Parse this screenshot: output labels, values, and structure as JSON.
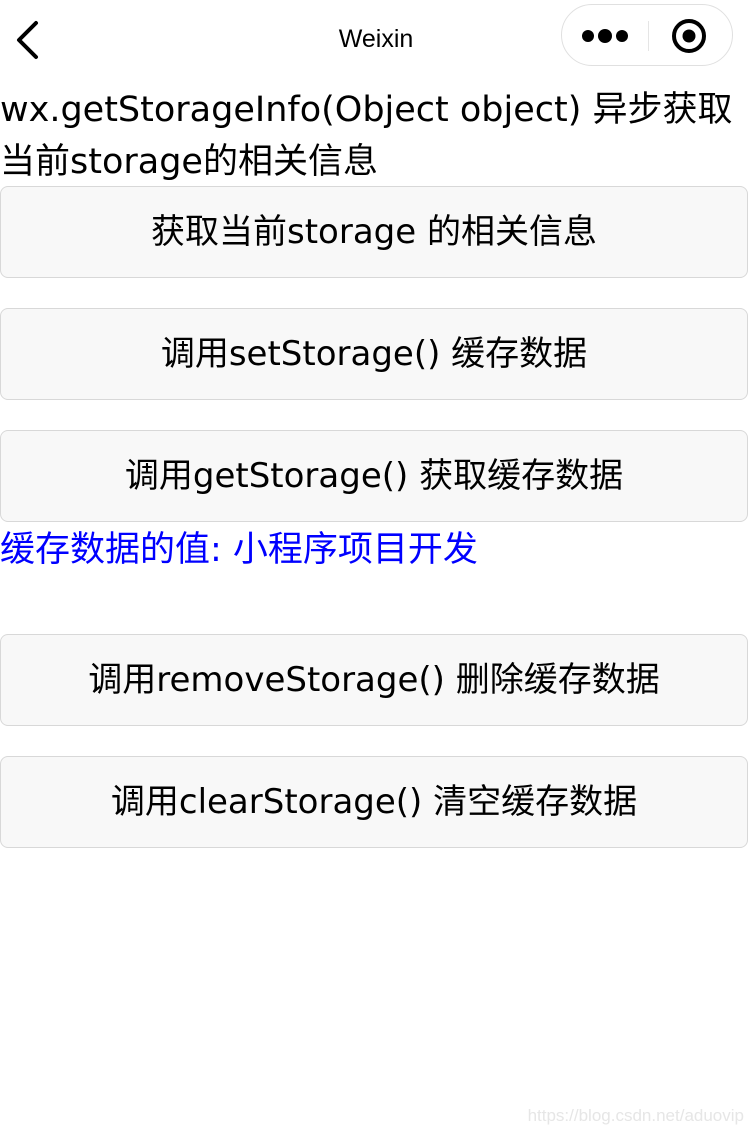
{
  "nav": {
    "title": "Weixin",
    "back_icon": "chevron-left-icon",
    "more_icon": "more-dots-icon",
    "close_icon": "close-circle-icon"
  },
  "description": "wx.getStorageInfo(Object object) 异步获取当前storage的相关信息",
  "buttons": [
    {
      "label": "获取当前storage 的相关信息"
    },
    {
      "label": "调用setStorage() 缓存数据"
    },
    {
      "label": "调用getStorage() 获取缓存数据"
    },
    {
      "label": "调用removeStorage() 删除缓存数据"
    },
    {
      "label": "调用clearStorage() 清空缓存数据"
    }
  ],
  "cached_value_text": "缓存数据的值: 小程序项目开发",
  "watermark": "https://blog.csdn.net/aduovip",
  "colors": {
    "cached_value_text": "#0000ff",
    "button_background": "#f8f8f8",
    "button_border": "#d8d8d8"
  }
}
